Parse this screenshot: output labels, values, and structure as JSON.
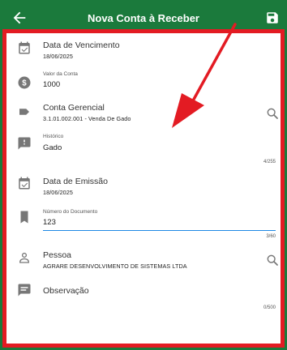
{
  "header": {
    "title": "Nova Conta à Receber",
    "back_icon": "arrow-left-icon",
    "save_icon": "floppy-disk-icon"
  },
  "colors": {
    "header": "#1b7a3c",
    "highlight_border": "#e31b23",
    "annotation_arrow": "#e31b23",
    "focus_underline": "#1e88e5"
  },
  "form": {
    "vencimento": {
      "label": "Data de Vencimento",
      "value": "18/06/2025"
    },
    "valor": {
      "label": "Valor da Conta",
      "value": "1000"
    },
    "conta_gerencial": {
      "label": "Conta Gerencial",
      "value": "3.1.01.002.001 - Venda De Gado"
    },
    "historico": {
      "label": "Histórico",
      "value": "Gado",
      "counter": "4/255"
    },
    "emissao": {
      "label": "Data de Emissão",
      "value": "18/06/2025"
    },
    "documento": {
      "label": "Número do Documento",
      "value": "123",
      "counter": "3/60"
    },
    "pessoa": {
      "label": "Pessoa",
      "value": "AGRARE DESENVOLVIMENTO DE SISTEMAS LTDA"
    },
    "observacao": {
      "label": "Observação",
      "counter": "0/500"
    }
  }
}
